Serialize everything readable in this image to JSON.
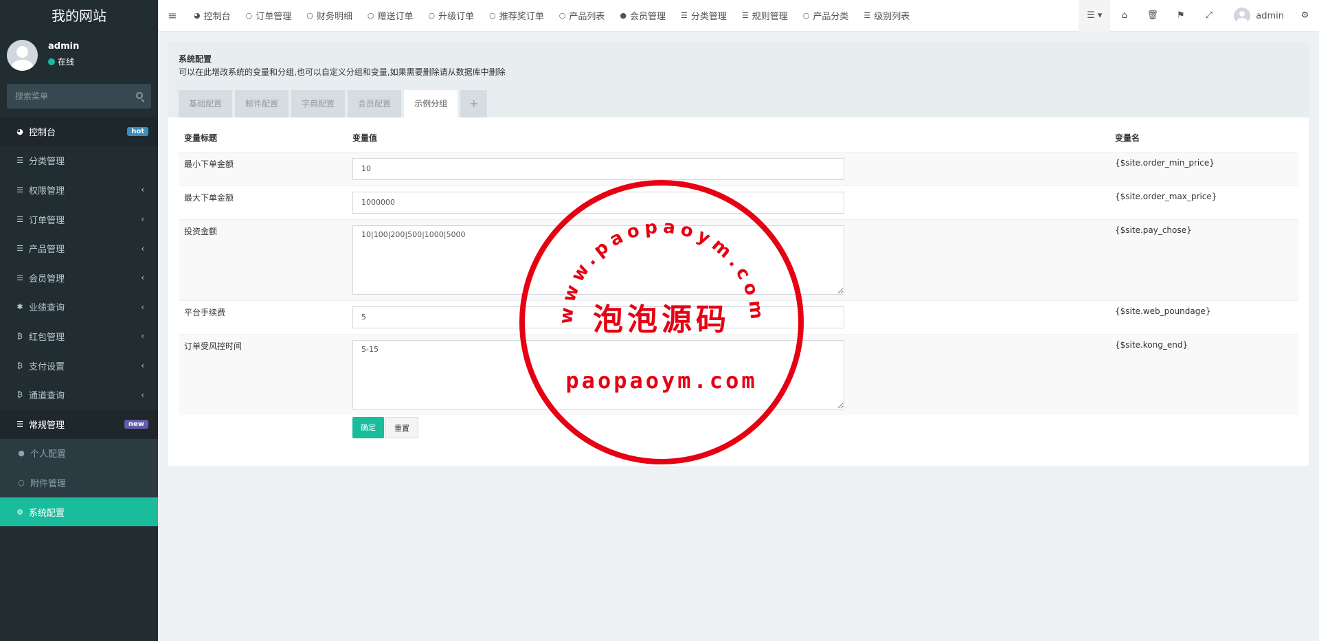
{
  "brand": "我的网站",
  "user": {
    "name": "admin",
    "status": "在线"
  },
  "search": {
    "placeholder": "搜索菜单"
  },
  "sidebar": {
    "items": [
      {
        "label": "控制台",
        "badge": "hot"
      },
      {
        "label": "分类管理"
      },
      {
        "label": "权限管理"
      },
      {
        "label": "订单管理"
      },
      {
        "label": "产品管理"
      },
      {
        "label": "会员管理"
      },
      {
        "label": "业绩查询"
      },
      {
        "label": "红包管理"
      },
      {
        "label": "支付设置"
      },
      {
        "label": "通道查询"
      },
      {
        "label": "常规管理",
        "badge": "new"
      },
      {
        "label": "个人配置"
      },
      {
        "label": "附件管理"
      },
      {
        "label": "系统配置"
      }
    ]
  },
  "topnav": {
    "items": [
      "控制台",
      "订单管理",
      "财务明细",
      "赠送订单",
      "升级订单",
      "推荐奖订单",
      "产品列表",
      "会员管理",
      "分类管理",
      "规则管理",
      "产品分类",
      "级别列表"
    ],
    "user": "admin"
  },
  "page": {
    "title": "系统配置",
    "description": "可以在此增改系统的变量和分组,也可以自定义分组和变量,如果需要删除请从数据库中删除",
    "tabs": [
      "基础配置",
      "邮件配置",
      "字典配置",
      "会员配置",
      "示例分组",
      "+"
    ],
    "active_tab": "示例分组"
  },
  "table": {
    "headers": {
      "title": "变量标题",
      "value": "变量值",
      "name": "变量名"
    },
    "rows": [
      {
        "title": "最小下单金额",
        "value": "10",
        "name": "{$site.order_min_price}"
      },
      {
        "title": "最大下单金额",
        "value": "1000000",
        "name": "{$site.order_max_price}"
      },
      {
        "title": "投资金额",
        "value": "10|100|200|500|1000|5000",
        "name": "{$site.pay_chose}"
      },
      {
        "title": "平台手续费",
        "value": "5",
        "name": "{$site.web_poundage}"
      },
      {
        "title": "订单受风控时间",
        "value": "5-15",
        "name": "{$site.kong_end}"
      }
    ]
  },
  "buttons": {
    "submit": "确定",
    "reset": "重置"
  },
  "watermark": {
    "top_text": "www.paopaoym.com",
    "center_text": "泡泡源码",
    "bottom_text": "paopaoym.com"
  },
  "colors": {
    "accent": "#1abc9c",
    "sidebar": "#222d32",
    "stamp": "#e60012"
  }
}
